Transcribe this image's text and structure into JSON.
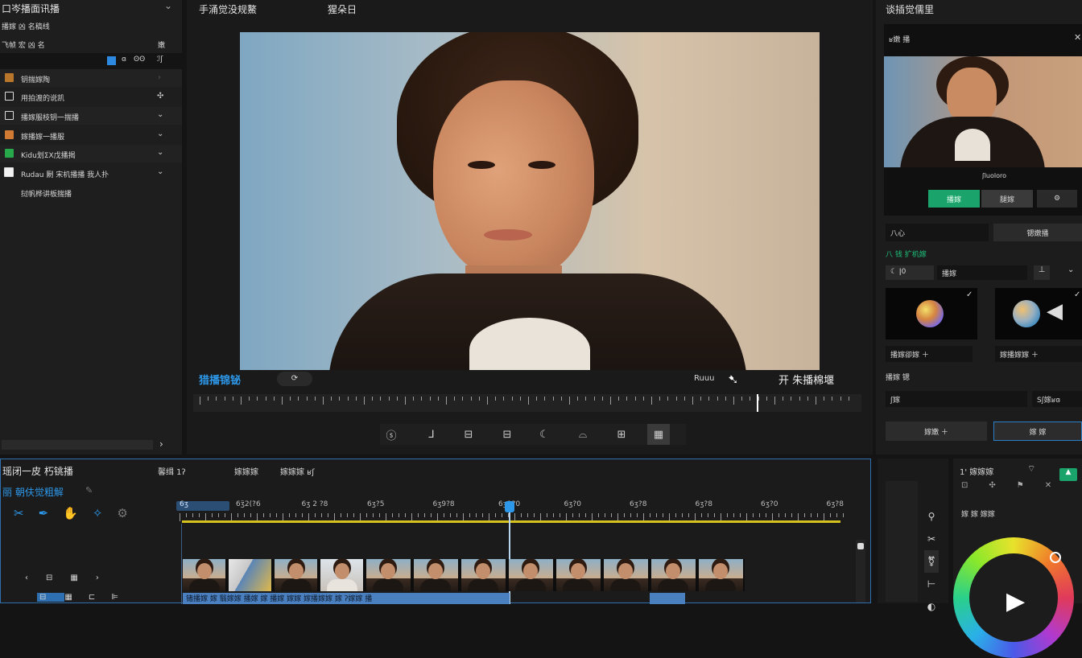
{
  "left": {
    "title": "口岑播面讯播",
    "sub1": "播嫁 凶 名稿线",
    "sub2": "飞帧 宏 凶 名",
    "sub2_right": "嫩",
    "bar_icon_labels": [
      "■",
      "ɞ",
      "ʘʘ",
      "ℐʃ"
    ],
    "items": [
      {
        "label": "钥揣嫁陶"
      },
      {
        "label": "用拍渡的说凯"
      },
      {
        "label": "播嫁服枝钥一揣播"
      },
      {
        "label": "嫁播嫁一播服"
      },
      {
        "label": "Kidu划ΣX戊播揭"
      },
      {
        "label": "Rudau 劂 宋机播播 我人扑"
      },
      {
        "label": "挝帆桦讲板揣播"
      }
    ],
    "footer_arrow": "›"
  },
  "viewer": {
    "title": "手涌觉没规鰲",
    "title2": "猩朵日",
    "overlay_left": "猎播锦铋",
    "overlay_right_small": "Ruuu",
    "overlay_right_big": "开 朱播棉堰",
    "toolbar": [
      "ⓢ",
      "⅃",
      "⊟",
      "⊟",
      "☾",
      "⌓",
      "⊞",
      "▦"
    ]
  },
  "right": {
    "title": "谈插觉儒里",
    "preview_head": "ʁ嫩 播",
    "preview_caption": "ʃluoloro",
    "btn_apply": "播嫁",
    "btn_second": "腿嫁",
    "tab_left": "八心",
    "tab_right": "锶嫩播",
    "section_label": "八 钱 扩机嫁",
    "field_label": "播嫁",
    "card1_label": "播嫁卻嫁 ＋",
    "card2_label": "嫁播嫁嫁 ＋",
    "row_label": "播嫁 锶",
    "field2_left": "ʃ嫁",
    "field2_right": "Sʃ嫁ʁɞ",
    "btn_add": "嫁嫩 ＋",
    "btn_ok": "嫁 嫁"
  },
  "timeline": {
    "title": "瑶闭一皮 朽铫播",
    "tab2": "馨缉 1ʔ",
    "tab3": "嫁嫁嫁",
    "tab4": "嫁嫁嫁 ʁʃ",
    "sub": "丽 朝伕觉粗解",
    "time_labels": [
      "6ʒ",
      "6ʒ̈2(?6",
      "6ʒ 2 ?8",
      "6ʒ?5",
      "6ʒ9?8",
      "6ʒ1?0",
      "6ʒ?0",
      "6ʒ?8",
      "6ʒ?8",
      "6ʒ?0",
      "6ʒ?8"
    ],
    "track_text": "锗播嫁 嫁 翳嫁嫁 播嫁 嫁 播嫁 嫁嫁 嫁播嫁嫁 嫁 ʔ嫁嫁 播"
  },
  "color": {
    "title": "1' 嫁嫁嫁",
    "sub": "嫁 嫁 嫁嫁"
  },
  "colors": {
    "accent": "#1aa36a",
    "blue": "#2d98ea",
    "timeline_bar": "#d6c21f"
  }
}
